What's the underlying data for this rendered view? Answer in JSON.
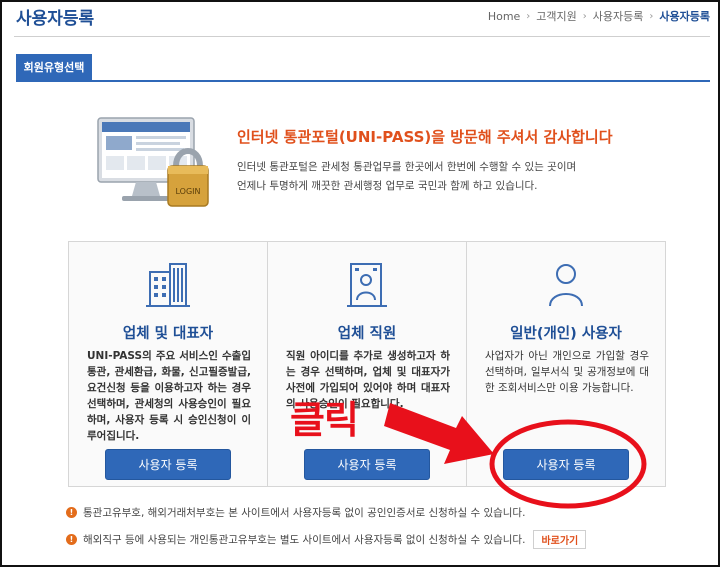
{
  "page": {
    "title": "사용자등록"
  },
  "breadcrumb": [
    "Home",
    "고객지원",
    "사용자등록",
    "사용자등록"
  ],
  "tab": {
    "label": "회원유형선택"
  },
  "welcome": {
    "title": "인터넷 통관포털(UNI-PASS)을 방문해 주셔서 감사합니다",
    "desc_line1": "인터넷 통관포털은 관세청 통관업무를 한곳에서 한번에 수행할 수 있는 곳이며",
    "desc_line2": "언제나 투명하게 깨끗한 관세행정 업무로 국민과 함께 하고 있습니다.",
    "illustration_label": "LOGIN"
  },
  "cards": [
    {
      "icon": "building-icon",
      "title": "업체 및 대표자",
      "desc": "UNI-PASS의 주요 서비스인 수출입통관, 관세환급, 화물, 신고필증발급, 요건신청 등을 이용하고자 하는 경우 선택하며, 관세청의 사용승인이 필요하며, 사용자 등록 시 승인신청이 이루어집니다.",
      "button": "사용자 등록"
    },
    {
      "icon": "employee-icon",
      "title": "업체 직원",
      "desc": "직원 아이디를 추가로 생성하고자 하는 경우 선택하며, 업체 및 대표자가 사전에 가입되어 있어야 하며 대표자의 사용승인이 필요합니다.",
      "button": "사용자 등록"
    },
    {
      "icon": "person-icon",
      "title": "일반(개인) 사용자",
      "desc": "사업자가 아닌 개인으로 가입할 경우 선택하며, 일부서식 및 공개정보에 대한 조회서비스만 이용 가능합니다.",
      "button": "사용자 등록"
    }
  ],
  "notices": [
    {
      "text": "통관고유부호, 해외거래처부호는 본 사이트에서 사용자등록 없이 공인인증서로 신청하실 수 있습니다."
    },
    {
      "text": "해외직구 등에 사용되는 개인통관고유부호는 별도 사이트에서 사용자등록 없이 신청하실 수 있습니다.",
      "button": "바로가기"
    }
  ],
  "annotation": {
    "label": "클릭"
  },
  "colors": {
    "primary": "#2f68b8",
    "accent": "#e0501c",
    "annotation": "#e8101b"
  }
}
